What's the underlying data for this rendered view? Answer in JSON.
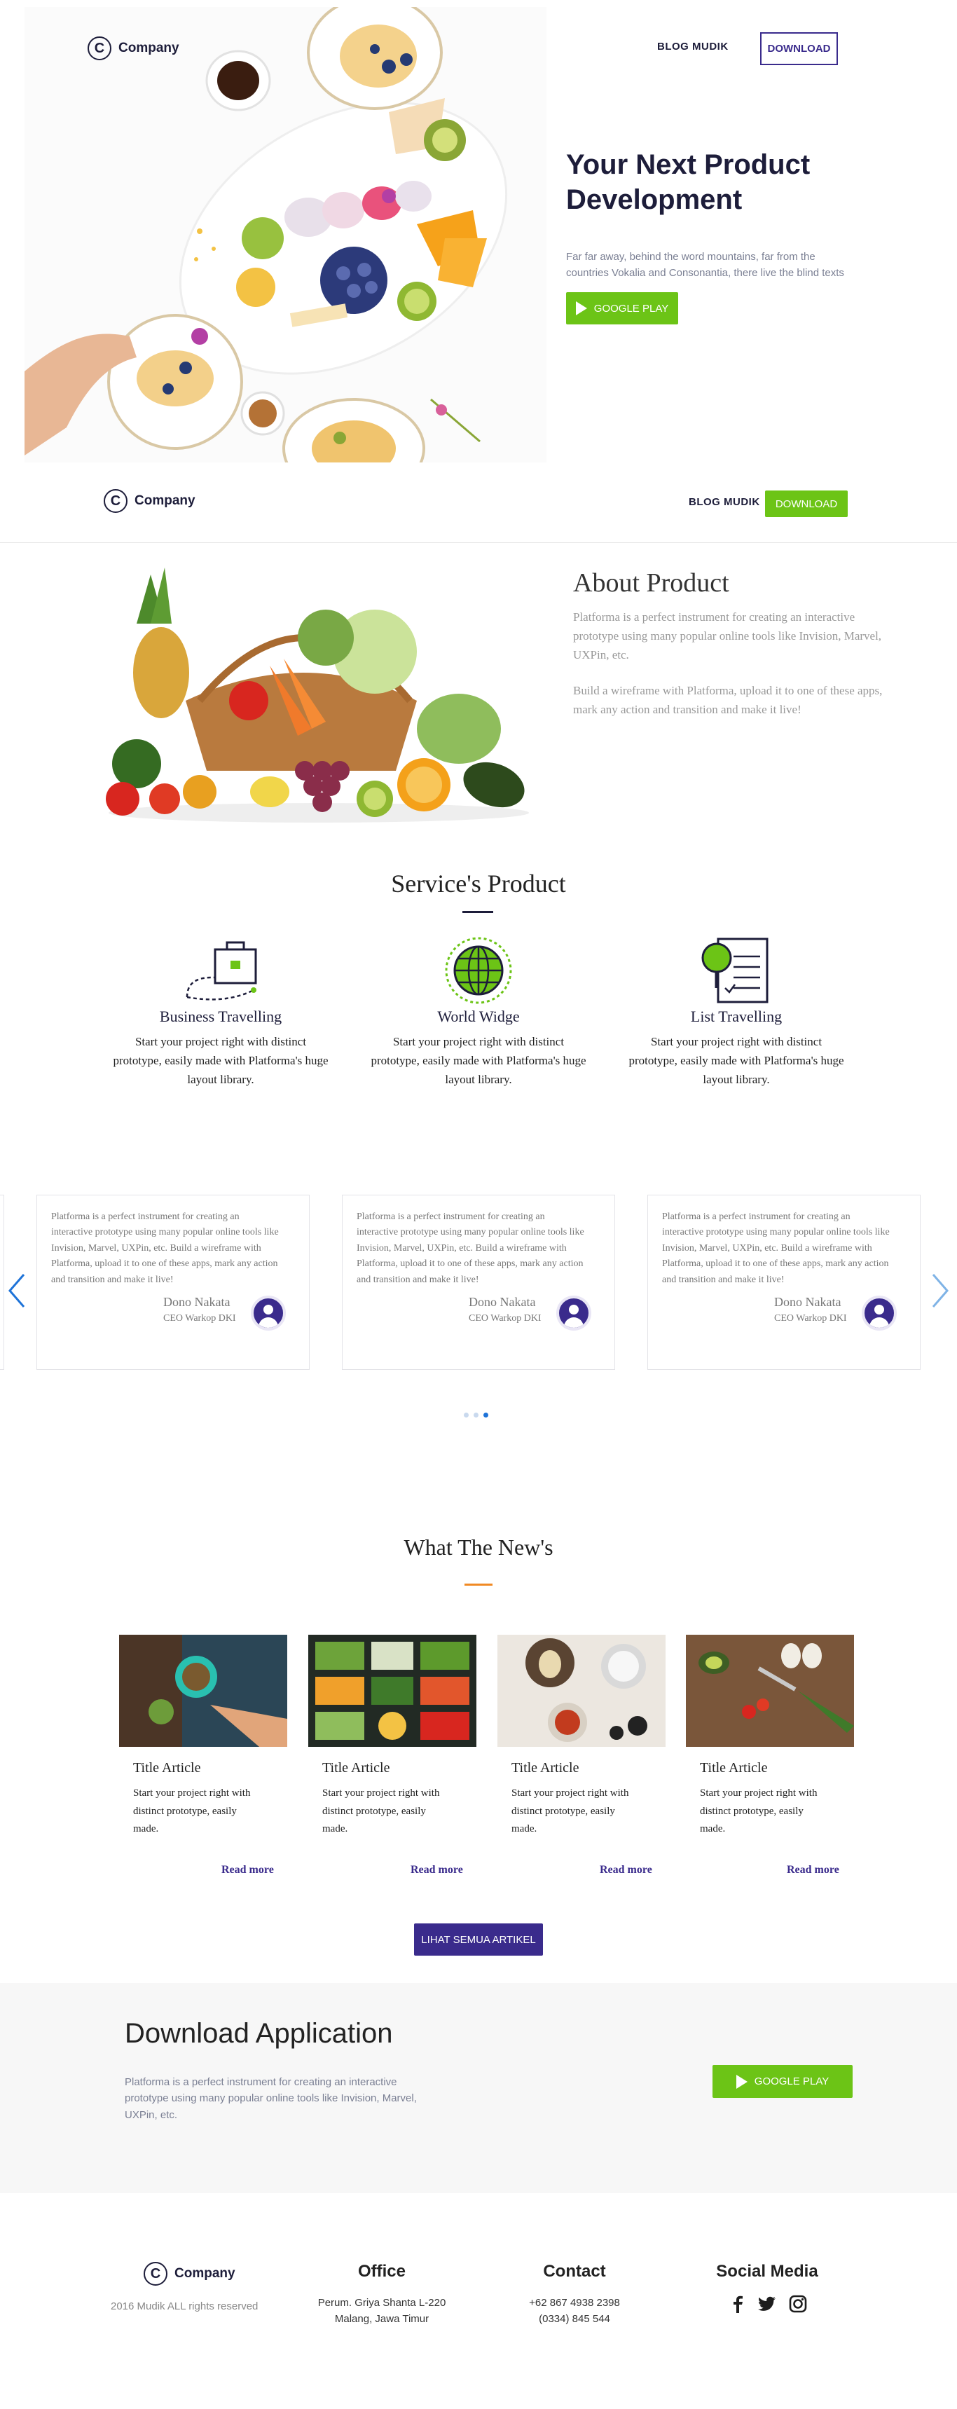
{
  "header": {
    "logo_mark": "C",
    "logo_text": "Company",
    "nav_blog": "BLOG MUDIK",
    "nav_download": "DOWNLOAD"
  },
  "hero": {
    "title_line1": "Your Next Product",
    "title_line2": "Development",
    "text_line1": "Far far away, behind the word mountains, far from the",
    "text_line2": "countries Vokalia and Consonantia, there live the blind texts",
    "cta_label": "GOOGLE PLAY"
  },
  "sticky_nav": {
    "logo_mark": "C",
    "logo_text": "Company",
    "nav_blog": "BLOG MUDIK",
    "nav_download": "DOWNLOAD"
  },
  "about": {
    "title": "About Product",
    "para1_line1": "Platforma is a perfect instrument for creating an interactive",
    "para1_line2": "prototype using many popular online tools like Invision, Marvel,",
    "para1_line3": "UXPin, etc.",
    "para2_line1": "Build a wireframe with Platforma, upload it to one of these apps,",
    "para2_line2": "mark any action and transition and make it live!"
  },
  "services": {
    "title": "Service's Product",
    "items": [
      {
        "title": "Business Travelling",
        "text_line1": "Start your project right with distinct",
        "text_line2": "prototype, easily made with Platforma's huge",
        "text_line3": "layout library."
      },
      {
        "title": "World Widge",
        "text_line1": "Start your project right with distinct",
        "text_line2": "prototype, easily made with Platforma's huge",
        "text_line3": "layout library."
      },
      {
        "title": "List Travelling",
        "text_line1": "Start your project right with distinct",
        "text_line2": "prototype, easily made with Platforma's huge",
        "text_line3": "layout library."
      }
    ]
  },
  "testimonials": {
    "items": [
      {
        "l1": "Platforma is a perfect instrument for creating an",
        "l2": "interactive prototype using many popular online tools like",
        "l3": "Invision, Marvel, UXPin, etc. Build a wireframe with",
        "l4": "Platforma, upload it to one of these apps, mark any action",
        "l5": "and transition and make it live!",
        "name": "Dono Nakata",
        "role": "CEO Warkop DKI"
      },
      {
        "l1": "Platforma is a perfect instrument for creating an",
        "l2": "interactive prototype using many popular online tools like",
        "l3": "Invision, Marvel, UXPin, etc. Build a wireframe with",
        "l4": "Platforma, upload it to one of these apps, mark any action",
        "l5": "and transition and make it live!",
        "name": "Dono Nakata",
        "role": "CEO Warkop DKI"
      },
      {
        "l1": "Platforma is a perfect instrument for creating an",
        "l2": "interactive prototype using many popular online tools like",
        "l3": "Invision, Marvel, UXPin, etc. Build a wireframe with",
        "l4": "Platforma, upload it to one of these apps, mark any action",
        "l5": "and transition and make it live!",
        "name": "Dono Nakata",
        "role": "CEO Warkop DKI"
      }
    ],
    "prev_icon": "chevron-left-icon",
    "next_icon": "chevron-right-icon",
    "dots_total": 3,
    "dots_active": 3
  },
  "news": {
    "title": "What The New's",
    "items": [
      {
        "title": "Title Article",
        "l1": "Start your project right with",
        "l2": "distinct prototype, easily",
        "l3": "made.",
        "more": "Read more"
      },
      {
        "title": "Title Article",
        "l1": "Start your project right with",
        "l2": "distinct prototype, easily",
        "l3": "made.",
        "more": "Read more"
      },
      {
        "title": "Title Article",
        "l1": "Start your project right with",
        "l2": "distinct prototype, easily",
        "l3": "made.",
        "more": "Read more"
      },
      {
        "title": "Title Article",
        "l1": "Start your project right with",
        "l2": "distinct prototype, easily",
        "l3": "made.",
        "more": "Read more"
      }
    ],
    "all_label": "LIHAT SEMUA ARTIKEL"
  },
  "download": {
    "title": "Download Application",
    "line1": "Platforma is a perfect instrument for creating an interactive",
    "line2": "prototype using many popular online tools like Invision, Marvel,",
    "line3": "UXPin, etc.",
    "cta_label": "GOOGLE PLAY"
  },
  "footer": {
    "logo_mark": "C",
    "logo_text": "Company",
    "copyright": "2016 Mudik ALL rights reserved",
    "office_head": "Office",
    "office_line1": "Perum. Griya Shanta L-220",
    "office_line2": "Malang, Jawa Timur",
    "contact_head": "Contact",
    "contact_line1": "+62 867 4938 2398",
    "contact_line2": "(0334) 845 544",
    "social_head": "Social Media",
    "social_icons": [
      "facebook-icon",
      "twitter-icon",
      "instagram-icon"
    ]
  },
  "colors": {
    "accent_green": "#6cc416",
    "accent_purple": "#3a2b8c",
    "navy": "#1d1d3a",
    "orange": "#f08a24",
    "gray_bg": "#f7f7f7"
  }
}
